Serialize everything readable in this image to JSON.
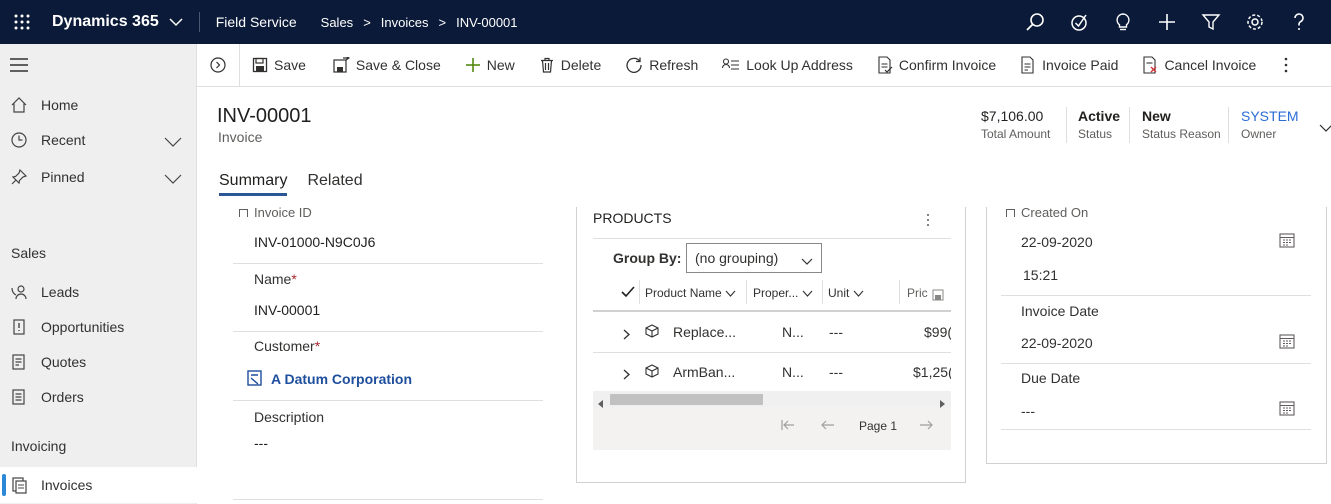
{
  "topbar": {
    "brand": "Dynamics 365",
    "app": "Field Service",
    "breadcrumb": [
      "Sales",
      "Invoices",
      "INV-00001"
    ]
  },
  "sidebar": {
    "items": [
      {
        "label": "Home",
        "icon": "home-icon"
      },
      {
        "label": "Recent",
        "icon": "clock-icon"
      },
      {
        "label": "Pinned",
        "icon": "pin-icon"
      }
    ],
    "sales_header": "Sales",
    "sales_items": [
      {
        "label": "Leads",
        "icon": "phone-person-icon"
      },
      {
        "label": "Opportunities",
        "icon": "document-icon"
      },
      {
        "label": "Quotes",
        "icon": "quote-icon"
      },
      {
        "label": "Orders",
        "icon": "order-icon"
      }
    ],
    "invoicing_header": "Invoicing",
    "invoicing_items": [
      {
        "label": "Invoices",
        "icon": "invoice-icon"
      }
    ]
  },
  "commands": {
    "save": "Save",
    "save_close": "Save & Close",
    "new": "New",
    "delete": "Delete",
    "refresh": "Refresh",
    "lookup": "Look Up Address",
    "confirm": "Confirm Invoice",
    "paid": "Invoice Paid",
    "cancel": "Cancel Invoice"
  },
  "header": {
    "title": "INV-00001",
    "entity": "Invoice",
    "total_amount": "$7,106.00",
    "total_amount_label": "Total Amount",
    "status": "Active",
    "status_label": "Status",
    "status_reason": "New",
    "status_reason_label": "Status Reason",
    "owner": "SYSTEM",
    "owner_label": "Owner"
  },
  "tabs": [
    "Summary",
    "Related"
  ],
  "summary": {
    "invoice_id_label": "Invoice ID",
    "invoice_id": "INV-01000-N9C0J6",
    "name_label": "Name",
    "name": "INV-00001",
    "customer_label": "Customer",
    "customer": "A Datum Corporation",
    "description_label": "Description",
    "description": "---",
    "required_marker": "*"
  },
  "products": {
    "title": "PRODUCTS",
    "group_by_label": "Group By:",
    "group_by_value": "(no grouping)",
    "columns": [
      "Product Name",
      "Proper...",
      "Unit",
      "Pric"
    ],
    "rows": [
      {
        "name": "Replace...",
        "prop": "N...",
        "unit": "---",
        "price": "$99("
      },
      {
        "name": "ArmBan...",
        "prop": "N...",
        "unit": "---",
        "price": "$1,25("
      }
    ],
    "page": "Page 1"
  },
  "dates": {
    "created_on_label": "Created On",
    "created_on_date": "22-09-2020",
    "created_on_time": "15:21",
    "invoice_date_label": "Invoice Date",
    "invoice_date": "22-09-2020",
    "due_date_label": "Due Date",
    "due_date": "---"
  },
  "colors": {
    "topbar": "#0b1a38",
    "link": "#1e4e9c",
    "owner": "#2b6cd6",
    "required": "#a4262c"
  }
}
